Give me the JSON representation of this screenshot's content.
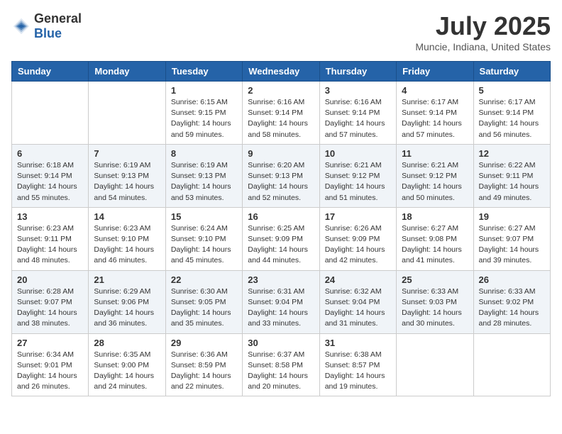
{
  "header": {
    "logo_general": "General",
    "logo_blue": "Blue",
    "month_year": "July 2025",
    "location": "Muncie, Indiana, United States"
  },
  "days_of_week": [
    "Sunday",
    "Monday",
    "Tuesday",
    "Wednesday",
    "Thursday",
    "Friday",
    "Saturday"
  ],
  "weeks": [
    [
      {
        "day": "",
        "sunrise": "",
        "sunset": "",
        "daylight": ""
      },
      {
        "day": "",
        "sunrise": "",
        "sunset": "",
        "daylight": ""
      },
      {
        "day": "1",
        "sunrise": "Sunrise: 6:15 AM",
        "sunset": "Sunset: 9:15 PM",
        "daylight": "Daylight: 14 hours and 59 minutes."
      },
      {
        "day": "2",
        "sunrise": "Sunrise: 6:16 AM",
        "sunset": "Sunset: 9:14 PM",
        "daylight": "Daylight: 14 hours and 58 minutes."
      },
      {
        "day": "3",
        "sunrise": "Sunrise: 6:16 AM",
        "sunset": "Sunset: 9:14 PM",
        "daylight": "Daylight: 14 hours and 57 minutes."
      },
      {
        "day": "4",
        "sunrise": "Sunrise: 6:17 AM",
        "sunset": "Sunset: 9:14 PM",
        "daylight": "Daylight: 14 hours and 57 minutes."
      },
      {
        "day": "5",
        "sunrise": "Sunrise: 6:17 AM",
        "sunset": "Sunset: 9:14 PM",
        "daylight": "Daylight: 14 hours and 56 minutes."
      }
    ],
    [
      {
        "day": "6",
        "sunrise": "Sunrise: 6:18 AM",
        "sunset": "Sunset: 9:14 PM",
        "daylight": "Daylight: 14 hours and 55 minutes."
      },
      {
        "day": "7",
        "sunrise": "Sunrise: 6:19 AM",
        "sunset": "Sunset: 9:13 PM",
        "daylight": "Daylight: 14 hours and 54 minutes."
      },
      {
        "day": "8",
        "sunrise": "Sunrise: 6:19 AM",
        "sunset": "Sunset: 9:13 PM",
        "daylight": "Daylight: 14 hours and 53 minutes."
      },
      {
        "day": "9",
        "sunrise": "Sunrise: 6:20 AM",
        "sunset": "Sunset: 9:13 PM",
        "daylight": "Daylight: 14 hours and 52 minutes."
      },
      {
        "day": "10",
        "sunrise": "Sunrise: 6:21 AM",
        "sunset": "Sunset: 9:12 PM",
        "daylight": "Daylight: 14 hours and 51 minutes."
      },
      {
        "day": "11",
        "sunrise": "Sunrise: 6:21 AM",
        "sunset": "Sunset: 9:12 PM",
        "daylight": "Daylight: 14 hours and 50 minutes."
      },
      {
        "day": "12",
        "sunrise": "Sunrise: 6:22 AM",
        "sunset": "Sunset: 9:11 PM",
        "daylight": "Daylight: 14 hours and 49 minutes."
      }
    ],
    [
      {
        "day": "13",
        "sunrise": "Sunrise: 6:23 AM",
        "sunset": "Sunset: 9:11 PM",
        "daylight": "Daylight: 14 hours and 48 minutes."
      },
      {
        "day": "14",
        "sunrise": "Sunrise: 6:23 AM",
        "sunset": "Sunset: 9:10 PM",
        "daylight": "Daylight: 14 hours and 46 minutes."
      },
      {
        "day": "15",
        "sunrise": "Sunrise: 6:24 AM",
        "sunset": "Sunset: 9:10 PM",
        "daylight": "Daylight: 14 hours and 45 minutes."
      },
      {
        "day": "16",
        "sunrise": "Sunrise: 6:25 AM",
        "sunset": "Sunset: 9:09 PM",
        "daylight": "Daylight: 14 hours and 44 minutes."
      },
      {
        "day": "17",
        "sunrise": "Sunrise: 6:26 AM",
        "sunset": "Sunset: 9:09 PM",
        "daylight": "Daylight: 14 hours and 42 minutes."
      },
      {
        "day": "18",
        "sunrise": "Sunrise: 6:27 AM",
        "sunset": "Sunset: 9:08 PM",
        "daylight": "Daylight: 14 hours and 41 minutes."
      },
      {
        "day": "19",
        "sunrise": "Sunrise: 6:27 AM",
        "sunset": "Sunset: 9:07 PM",
        "daylight": "Daylight: 14 hours and 39 minutes."
      }
    ],
    [
      {
        "day": "20",
        "sunrise": "Sunrise: 6:28 AM",
        "sunset": "Sunset: 9:07 PM",
        "daylight": "Daylight: 14 hours and 38 minutes."
      },
      {
        "day": "21",
        "sunrise": "Sunrise: 6:29 AM",
        "sunset": "Sunset: 9:06 PM",
        "daylight": "Daylight: 14 hours and 36 minutes."
      },
      {
        "day": "22",
        "sunrise": "Sunrise: 6:30 AM",
        "sunset": "Sunset: 9:05 PM",
        "daylight": "Daylight: 14 hours and 35 minutes."
      },
      {
        "day": "23",
        "sunrise": "Sunrise: 6:31 AM",
        "sunset": "Sunset: 9:04 PM",
        "daylight": "Daylight: 14 hours and 33 minutes."
      },
      {
        "day": "24",
        "sunrise": "Sunrise: 6:32 AM",
        "sunset": "Sunset: 9:04 PM",
        "daylight": "Daylight: 14 hours and 31 minutes."
      },
      {
        "day": "25",
        "sunrise": "Sunrise: 6:33 AM",
        "sunset": "Sunset: 9:03 PM",
        "daylight": "Daylight: 14 hours and 30 minutes."
      },
      {
        "day": "26",
        "sunrise": "Sunrise: 6:33 AM",
        "sunset": "Sunset: 9:02 PM",
        "daylight": "Daylight: 14 hours and 28 minutes."
      }
    ],
    [
      {
        "day": "27",
        "sunrise": "Sunrise: 6:34 AM",
        "sunset": "Sunset: 9:01 PM",
        "daylight": "Daylight: 14 hours and 26 minutes."
      },
      {
        "day": "28",
        "sunrise": "Sunrise: 6:35 AM",
        "sunset": "Sunset: 9:00 PM",
        "daylight": "Daylight: 14 hours and 24 minutes."
      },
      {
        "day": "29",
        "sunrise": "Sunrise: 6:36 AM",
        "sunset": "Sunset: 8:59 PM",
        "daylight": "Daylight: 14 hours and 22 minutes."
      },
      {
        "day": "30",
        "sunrise": "Sunrise: 6:37 AM",
        "sunset": "Sunset: 8:58 PM",
        "daylight": "Daylight: 14 hours and 20 minutes."
      },
      {
        "day": "31",
        "sunrise": "Sunrise: 6:38 AM",
        "sunset": "Sunset: 8:57 PM",
        "daylight": "Daylight: 14 hours and 19 minutes."
      },
      {
        "day": "",
        "sunrise": "",
        "sunset": "",
        "daylight": ""
      },
      {
        "day": "",
        "sunrise": "",
        "sunset": "",
        "daylight": ""
      }
    ]
  ]
}
